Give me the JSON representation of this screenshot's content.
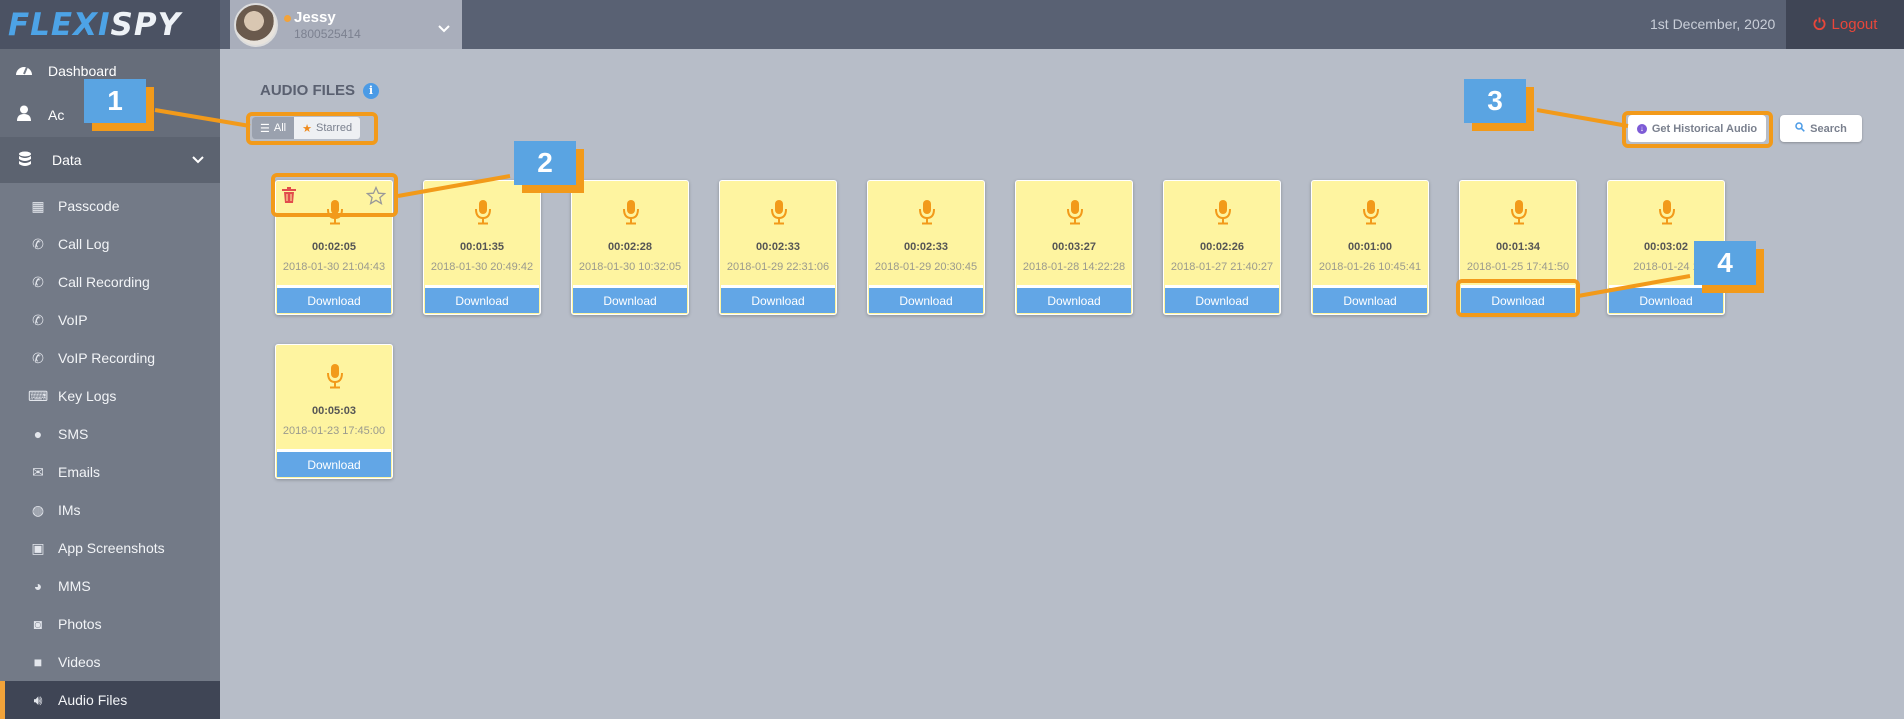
{
  "brand": {
    "part1": "FLEXI",
    "part2": "SPY"
  },
  "user": {
    "name": "Jessy",
    "phone": "1800525414"
  },
  "header": {
    "date": "1st December, 2020",
    "logout": "Logout"
  },
  "sidebar": {
    "top_items": [
      {
        "label": "Dashboard",
        "icon": "dashboard-icon"
      },
      {
        "label": "Ac",
        "icon": "user-icon"
      }
    ],
    "section": {
      "label": "Data",
      "icon": "database-icon"
    },
    "items": [
      {
        "label": "Passcode",
        "icon": "grid-icon"
      },
      {
        "label": "Call Log",
        "icon": "phone-icon"
      },
      {
        "label": "Call Recording",
        "icon": "phone-recording-icon"
      },
      {
        "label": "VoIP",
        "icon": "voip-icon"
      },
      {
        "label": "VoIP Recording",
        "icon": "voip-recording-icon"
      },
      {
        "label": "Key Logs",
        "icon": "keyboard-icon"
      },
      {
        "label": "SMS",
        "icon": "chat-bubble-icon"
      },
      {
        "label": "Emails",
        "icon": "envelope-icon"
      },
      {
        "label": "IMs",
        "icon": "chat-bubbles-icon"
      },
      {
        "label": "App Screenshots",
        "icon": "screenshot-icon"
      },
      {
        "label": "MMS",
        "icon": "mms-icon"
      },
      {
        "label": "Photos",
        "icon": "camera-icon"
      },
      {
        "label": "Videos",
        "icon": "video-icon"
      },
      {
        "label": "Audio Files",
        "icon": "speaker-icon"
      }
    ]
  },
  "page": {
    "title": "AUDIO FILES",
    "info_icon": "i"
  },
  "filter": {
    "all": "All",
    "starred": "Starred"
  },
  "actions": {
    "historical": "Get Historical Audio",
    "search": "Search"
  },
  "cards": [
    {
      "duration": "00:02:05",
      "timestamp": "2018-01-30 21:04:43",
      "download": "Download"
    },
    {
      "duration": "00:01:35",
      "timestamp": "2018-01-30 20:49:42",
      "download": "Download"
    },
    {
      "duration": "00:02:28",
      "timestamp": "2018-01-30 10:32:05",
      "download": "Download"
    },
    {
      "duration": "00:02:33",
      "timestamp": "2018-01-29 22:31:06",
      "download": "Download"
    },
    {
      "duration": "00:02:33",
      "timestamp": "2018-01-29 20:30:45",
      "download": "Download"
    },
    {
      "duration": "00:03:27",
      "timestamp": "2018-01-28 14:22:28",
      "download": "Download"
    },
    {
      "duration": "00:02:26",
      "timestamp": "2018-01-27 21:40:27",
      "download": "Download"
    },
    {
      "duration": "00:01:00",
      "timestamp": "2018-01-26 10:45:41",
      "download": "Download"
    },
    {
      "duration": "00:01:34",
      "timestamp": "2018-01-25 17:41:50",
      "download": "Download"
    },
    {
      "duration": "00:03:02",
      "timestamp": "2018-01-24 1",
      "download": "Download"
    },
    {
      "duration": "00:05:03",
      "timestamp": "2018-01-23 17:45:00",
      "download": "Download"
    }
  ],
  "callouts": [
    "1",
    "2",
    "3",
    "4"
  ],
  "colors": {
    "accent": "#f29a1a",
    "primary": "#62a6e6",
    "card": "#fef4a0",
    "logout": "#e8463a"
  }
}
